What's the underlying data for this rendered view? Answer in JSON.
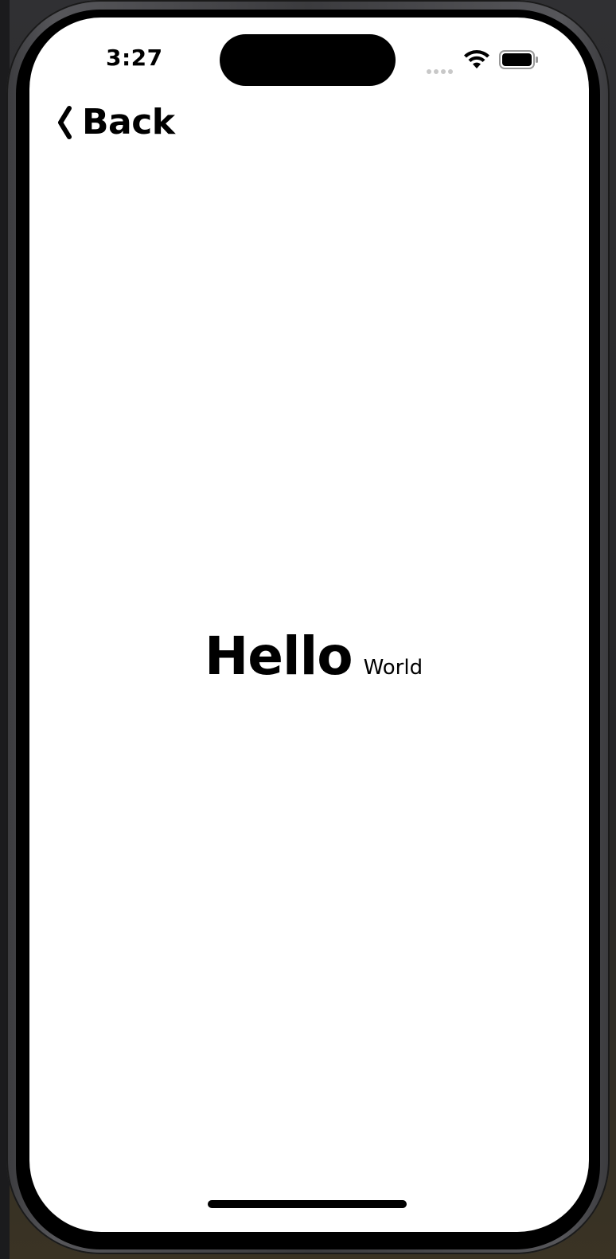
{
  "status_bar": {
    "time": "3:27",
    "icons": [
      "cellular-signal-icon",
      "wifi-icon",
      "battery-icon"
    ]
  },
  "nav": {
    "back_label": "Back",
    "back_icon": "chevron-left-icon"
  },
  "content": {
    "title": "Hello",
    "subtitle": "World"
  },
  "colors": {
    "text": "#000000",
    "screen_background": "#ffffff",
    "device_frame": "#000000"
  }
}
